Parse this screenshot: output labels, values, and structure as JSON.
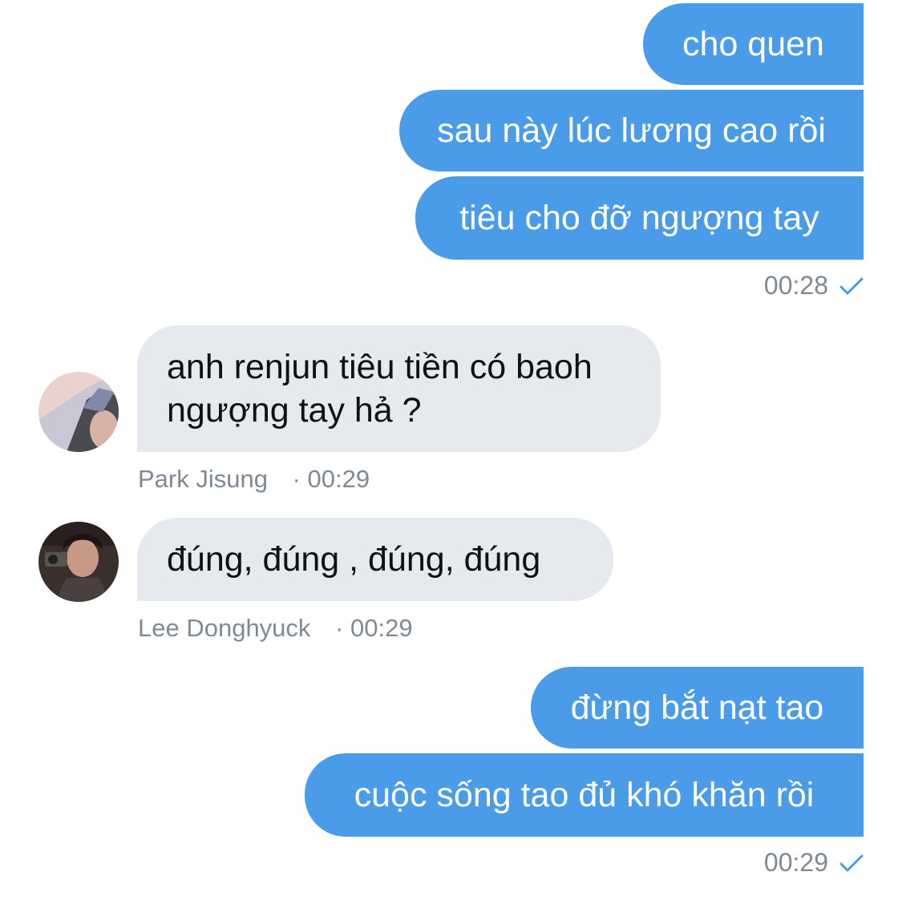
{
  "messages": [
    {
      "type": "outgoing",
      "text": "cho quen"
    },
    {
      "type": "outgoing",
      "text": "sau này lúc lương cao rồi"
    },
    {
      "type": "outgoing",
      "text": "tiêu cho đỡ ngượng tay"
    },
    {
      "type": "outgoing_time",
      "time": "00:28"
    },
    {
      "type": "incoming",
      "line1": "anh renjun tiêu tiền có baoh",
      "line2": "ngượng tay hả ?",
      "sender": "Park Jisung",
      "time": "· 00:29"
    },
    {
      "type": "incoming",
      "text": "đúng, đúng , đúng, đúng",
      "sender": "Lee Donghyuck",
      "time": "· 00:29"
    },
    {
      "type": "outgoing",
      "text": "đừng bắt nạt tao"
    },
    {
      "type": "outgoing",
      "text": "cuộc sống tao đủ khó khăn rồi"
    },
    {
      "type": "outgoing_time",
      "time": "00:29"
    }
  ],
  "colors": {
    "outgoing_bubble": "#4a9be8",
    "incoming_bubble": "#e6e9ee",
    "meta_text": "#7f8a95",
    "read_check": "#4a9be8"
  },
  "icons": [
    "read-check-icon",
    "avatar-park-jisung",
    "avatar-lee-donghyuck"
  ]
}
